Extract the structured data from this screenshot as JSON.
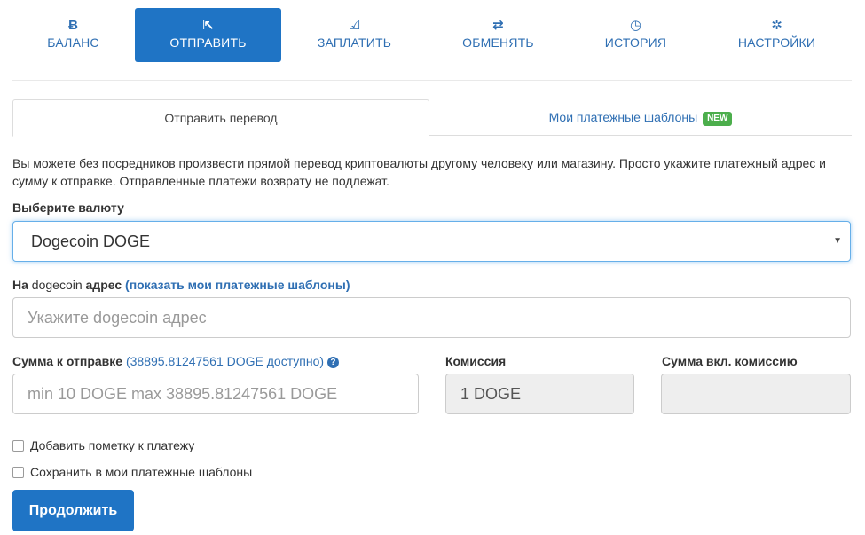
{
  "nav": {
    "items": [
      {
        "icon": "Ƀ",
        "label": "БАЛАНС"
      },
      {
        "icon": "⇱",
        "label": "ОТПРАВИТЬ"
      },
      {
        "icon": "☑",
        "label": "ЗАПЛАТИТЬ"
      },
      {
        "icon": "⇄",
        "label": "ОБМЕНЯТЬ"
      },
      {
        "icon": "◷",
        "label": "ИСТОРИЯ"
      },
      {
        "icon": "✲",
        "label": "НАСТРОЙКИ"
      }
    ],
    "active_index": 1
  },
  "tabs": {
    "send": "Отправить перевод",
    "templates": "Мои платежные шаблоны",
    "templates_badge": "NEW"
  },
  "description": "Вы можете без посредников произвести прямой перевод криптовалюты другому человеку или магазину. Просто укажите платежный адрес и сумму к отправке. Отправленные платежи возврату не подлежат.",
  "currency": {
    "label": "Выберите валюту",
    "selected": "Dogecoin DOGE",
    "caret": "▼"
  },
  "address": {
    "label_prefix": "На",
    "label_coin": "dogecoin",
    "label_suffix": "адрес",
    "templates_link": "(показать мои платежные шаблоны)",
    "placeholder": "Укажите dogecoin адрес"
  },
  "amount": {
    "label": "Сумма к отправке",
    "available": "(38895.81247561 DOGE доступно)",
    "help_icon": "?",
    "placeholder": "min 10 DOGE max 38895.81247561 DOGE"
  },
  "commission": {
    "label": "Комиссия",
    "value": "1 DOGE"
  },
  "total": {
    "label": "Сумма вкл. комиссию",
    "value": ""
  },
  "options": {
    "add_note": "Добавить пометку к платежу",
    "save_template": "Сохранить в мои платежные шаблоны"
  },
  "submit_label": "Продолжить",
  "colors": {
    "accent": "#1f74c5",
    "link": "#2f6fb3",
    "badge": "#4cae4c"
  }
}
